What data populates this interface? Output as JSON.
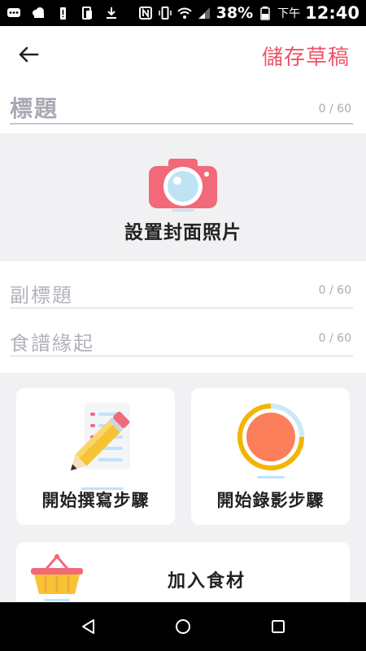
{
  "status_bar": {
    "battery_percent": "38%",
    "time_prefix": "下午",
    "time": "12:40",
    "icons": [
      "message-icon",
      "cloud-icon",
      "battery-alert-icon",
      "sim-icon",
      "download-icon",
      "nfc-icon",
      "vibrate-icon",
      "wifi-icon",
      "signal-icon",
      "battery-icon"
    ]
  },
  "header": {
    "back_icon": "arrow-left-icon",
    "save_draft_label": "儲存草稿"
  },
  "title_field": {
    "placeholder": "標題",
    "counter": "0 / 60"
  },
  "cover": {
    "icon": "camera-icon",
    "label": "設置封面照片"
  },
  "subtitle_field": {
    "placeholder": "副標題",
    "counter": "0 / 60"
  },
  "origin_field": {
    "placeholder": "食譜緣起",
    "counter": "0 / 60"
  },
  "actions": {
    "write_steps_label": "開始撰寫步驟",
    "record_steps_label": "開始錄影步驟",
    "add_ingredients_label": "加入食材"
  },
  "nav_bar": {
    "icons": [
      "nav-back-icon",
      "nav-home-icon",
      "nav-recent-icon"
    ]
  },
  "colors": {
    "accent": "#ee5466",
    "camera_pink": "#f2697a",
    "record_orange": "#fb7f5a",
    "pencil_yellow": "#f7c335",
    "background": "#f1f1f4"
  }
}
